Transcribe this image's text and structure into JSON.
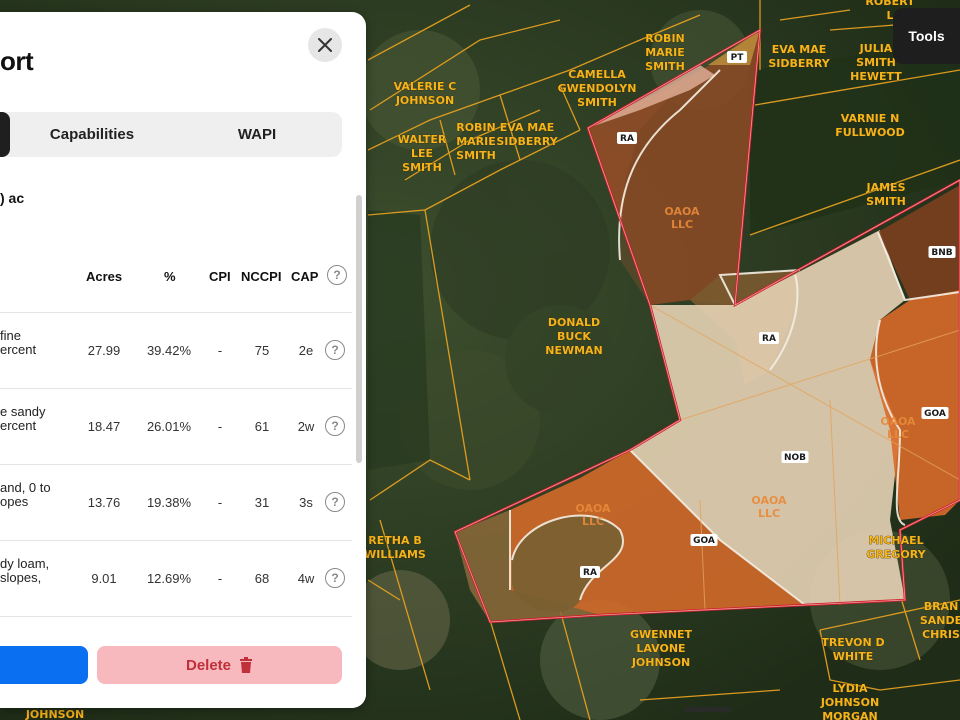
{
  "panel": {
    "title": "ort",
    "tabs": [
      {
        "label": "Capabilities"
      },
      {
        "label": "WAPI"
      }
    ],
    "acres_total": ") ac",
    "table": {
      "headers": {
        "acres": "Acres",
        "pct": "%",
        "cpi": "CPI",
        "nccpi": "NCCPI",
        "cap": "CAP"
      },
      "rows": [
        {
          "name_line1": "fine",
          "name_line2": "ercent",
          "name_line3": "",
          "acres": "27.99",
          "pct": "39.42%",
          "cpi": "-",
          "nccpi": "75",
          "cap": "2e"
        },
        {
          "name_line1": "e sandy",
          "name_line2": "ercent",
          "name_line3": "",
          "acres": "18.47",
          "pct": "26.01%",
          "cpi": "-",
          "nccpi": "61",
          "cap": "2w"
        },
        {
          "name_line1": "and, 0 to",
          "name_line2": "opes",
          "name_line3": "",
          "acres": "13.76",
          "pct": "19.38%",
          "cpi": "-",
          "nccpi": "31",
          "cap": "3s"
        },
        {
          "name_line1": "dy loam,",
          "name_line2": "slopes,",
          "name_line3": "",
          "acres": "9.01",
          "pct": "12.69%",
          "cpi": "-",
          "nccpi": "68",
          "cap": "4w"
        }
      ]
    },
    "delete_label": "Delete"
  },
  "toolbar": {
    "tools_label": "Tools"
  },
  "map": {
    "owner_labels": [
      {
        "id": "robert",
        "lines": [
          "ROBERT",
          "L"
        ]
      },
      {
        "id": "robin-marie-top",
        "lines": [
          "ROBIN",
          "MARIE",
          "SMITH"
        ]
      },
      {
        "id": "eva-mae-top",
        "lines": [
          "EVA MAE",
          "SIDBERRY"
        ]
      },
      {
        "id": "julia",
        "lines": [
          "JULIA",
          "SMITH",
          "HEWETT"
        ]
      },
      {
        "id": "valerie",
        "lines": [
          "VALERIE C",
          "JOHNSON"
        ]
      },
      {
        "id": "camella",
        "lines": [
          "CAMELLA",
          "GWENDOLYN",
          "SMITH"
        ]
      },
      {
        "id": "walter",
        "lines": [
          "WALTER",
          "LEE",
          "SMITH"
        ]
      },
      {
        "id": "robin-marie",
        "lines": [
          "ROBIN",
          "MARIE",
          "SMITH"
        ]
      },
      {
        "id": "eva-mae",
        "lines": [
          "EVA MAE",
          "SIDBERRY"
        ]
      },
      {
        "id": "varnie",
        "lines": [
          "VARNIE N",
          "FULLWOOD"
        ]
      },
      {
        "id": "james",
        "lines": [
          "JAMES",
          "SMITH"
        ]
      },
      {
        "id": "donald",
        "lines": [
          "DONALD",
          "BUCK",
          "NEWMAN"
        ]
      },
      {
        "id": "retha",
        "lines": [
          "RETHA B",
          "WILLIAMS"
        ]
      },
      {
        "id": "michael",
        "lines": [
          "MICHAEL",
          "GREGORY"
        ]
      },
      {
        "id": "gwennet",
        "lines": [
          "GWENNET",
          "LAVONE",
          "JOHNSON"
        ]
      },
      {
        "id": "trevon",
        "lines": [
          "TREVON D",
          "WHITE"
        ]
      },
      {
        "id": "lydia",
        "lines": [
          "LYDIA",
          "JOHNSON",
          "MORGAN"
        ]
      },
      {
        "id": "brand",
        "lines": [
          "BRAN",
          "SANDE",
          "CHRIS"
        ]
      },
      {
        "id": "johnson-bottom",
        "lines": [
          "JOHNSON"
        ]
      }
    ],
    "owner_in_field": [
      {
        "id": "oaoa-1",
        "lines": [
          "OAOA",
          "LLC"
        ]
      },
      {
        "id": "oaoa-2",
        "lines": [
          "OAOA",
          "LLC"
        ]
      },
      {
        "id": "oaoa-3",
        "lines": [
          "OAOA",
          "LLC"
        ]
      },
      {
        "id": "oaoa-4",
        "lines": [
          "OAOA",
          "LLC"
        ]
      }
    ],
    "soil_labels": [
      "PT",
      "RA",
      "BNB",
      "RA",
      "GOA",
      "NOB",
      "GOA",
      "RA"
    ]
  },
  "colors": {
    "accent_blue": "#0a6ff0",
    "delete_bg": "#f7b9bd",
    "delete_text": "#c0303a",
    "parcel_line": "#e6a020",
    "boundary_red": "#d21e2a"
  }
}
